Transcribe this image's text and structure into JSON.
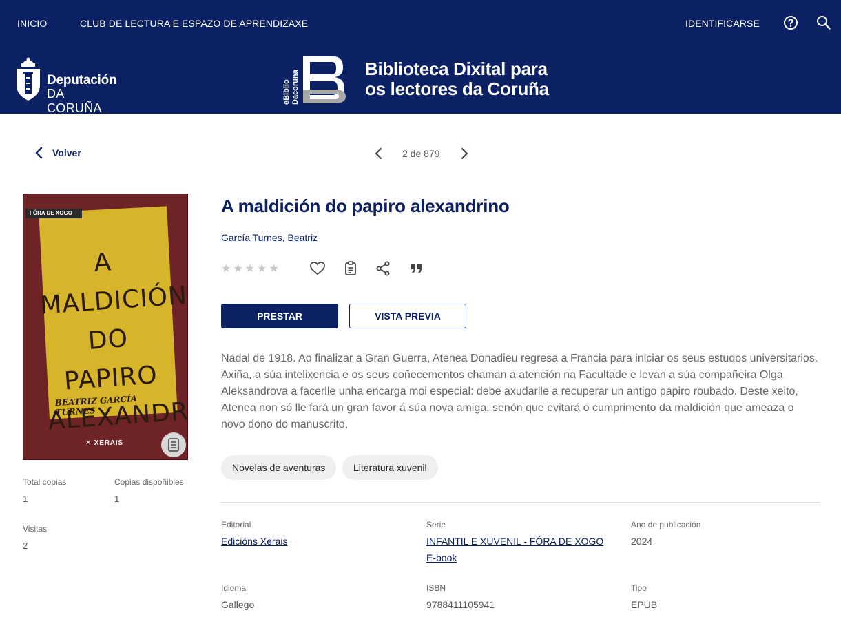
{
  "nav": {
    "home": "INICIO",
    "club": "CLUB DE LECTURA E ESPAZO DE APRENDIZAXE",
    "login": "IDENTIFICARSE",
    "help_icon": "help-circle-icon",
    "search_icon": "search-icon"
  },
  "brand": {
    "dep_line1": "Deputación",
    "dep_line2": "DA CORUÑA",
    "ebiblio_line1": "eBiblio",
    "ebiblio_line2": "Dacoruna",
    "site_title_line1": "Biblioteca Dixital para",
    "site_title_line2": "os lectores da Coruña"
  },
  "pager": {
    "back_label": "Volver",
    "position": "2 de 879"
  },
  "cover": {
    "collection": "FÓRA DE XOGO",
    "title_line1": "A MALDICIÓN",
    "title_line2": "DO PAPIRO",
    "title_line3": "ALEXANDRINO",
    "author": "BEATRIZ GARCÍA TURNES",
    "publisher": "XERAIS"
  },
  "stats": {
    "total_label": "Total copias",
    "total_value": "1",
    "available_label": "Copias dispoñibles",
    "available_value": "1",
    "visits_label": "Visitas",
    "visits_value": "2"
  },
  "book": {
    "title": "A maldición do papiro alexandrino",
    "author": "García Turnes, Beatriz",
    "rating": 0,
    "rating_max": 5,
    "borrow_label": "PRESTAR",
    "preview_label": "VISTA PREVIA",
    "description": "Nadal de 1918. Ao finalizar a Gran Guerra, Atenea Donadieu regresa a Francia para iniciar os seus estudos universitarios. Axiña, a súa intelixencia e os seus coñecementos chaman a atención na Facultade e levan a súa compañeira Olga Aleksandrova a facerlle unha encarga moi especial: debe axudarlle a recuperar un antigo papiro roubado. Deste xeito, Atenea non só lle fará un gran favor á súa nova amiga, senón que evitará o cumprimento da maldición que ameaza o novo dono do manuscrito.",
    "tags": [
      "Novelas de aventuras",
      "Literatura xuvenil"
    ]
  },
  "details": {
    "publisher_label": "Editorial",
    "publisher_value": "Edicións Xerais",
    "series_label": "Serie",
    "series_value": "INFANTIL E XUVENIL - FÓRA DE XOGO",
    "format_value": "E-book",
    "year_label": "Ano de publicación",
    "year_value": "2024",
    "language_label": "Idioma",
    "language_value": "Gallego",
    "isbn_label": "ISBN",
    "isbn_value": "9788411105941",
    "type_label": "Tipo",
    "type_value": "EPUB"
  },
  "colors": {
    "brand_navy": "#0b2163",
    "cover_red": "#6e2326",
    "cover_yellow": "#d7b52a"
  }
}
